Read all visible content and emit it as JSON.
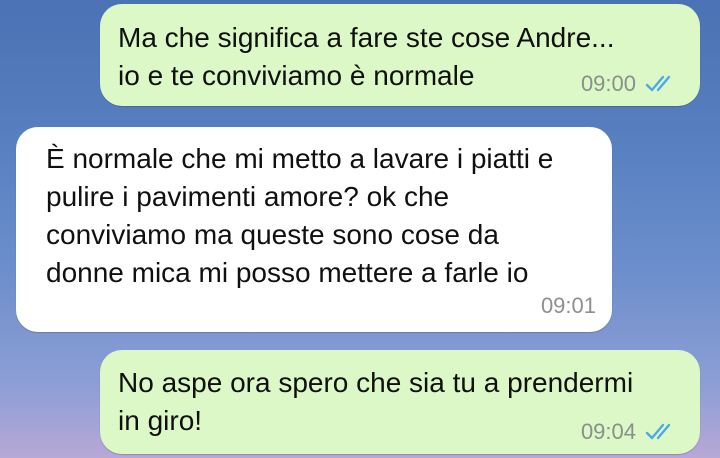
{
  "messages": [
    {
      "direction": "outgoing",
      "lines": [
        "Ma che significa a fare ste cose Andre...",
        "io e te conviviamo è normale"
      ],
      "time": "09:00",
      "status_icon": "double-check-read-icon"
    },
    {
      "direction": "incoming",
      "lines": [
        "È normale che mi metto a lavare i piatti e",
        "pulire i pavimenti amore? ok che",
        "conviviamo ma queste sono cose da",
        "donne mica mi posso mettere a farle io"
      ],
      "time": "09:01"
    },
    {
      "direction": "outgoing",
      "lines": [
        "No aspe ora spero che sia tu a prendermi",
        "in giro!"
      ],
      "time": "09:04",
      "status_icon": "double-check-read-icon"
    }
  ],
  "colors": {
    "outgoing_bubble": "#dcf8c6",
    "incoming_bubble": "#ffffff",
    "read_ticks": "#4fa8e8",
    "timestamp": "#8a8f8a"
  }
}
